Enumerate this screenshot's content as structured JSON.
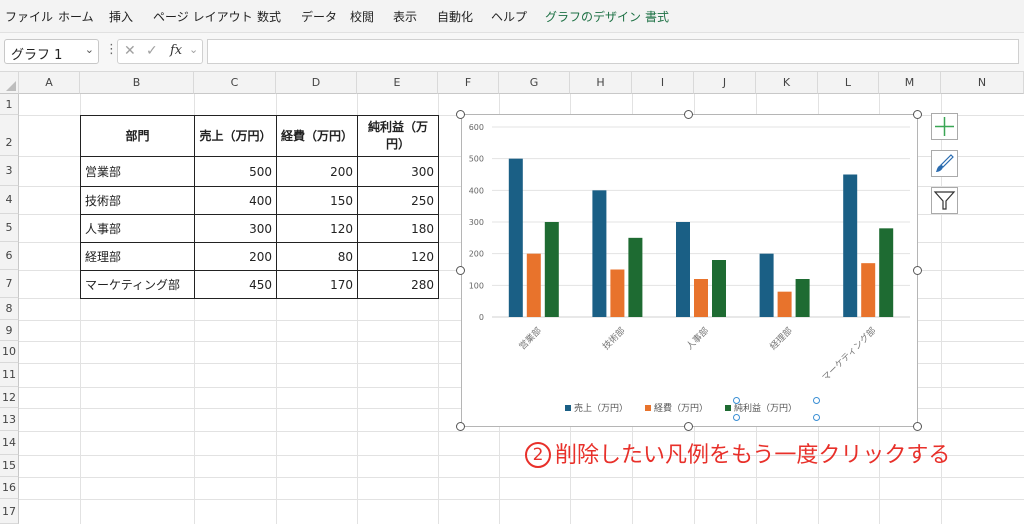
{
  "ribbon": {
    "tabs": [
      "ファイル",
      "ホーム",
      "挿入",
      "ページ レイアウト",
      "数式",
      "データ",
      "校閲",
      "表示",
      "自動化",
      "ヘルプ",
      "グラフのデザイン",
      "書式"
    ]
  },
  "formula_bar": {
    "name_box": "グラフ 1",
    "fx": "fx",
    "value": ""
  },
  "columns": [
    "A",
    "B",
    "C",
    "D",
    "E",
    "F",
    "G",
    "H",
    "I",
    "J",
    "K",
    "L",
    "M",
    "N"
  ],
  "rows": [
    "1",
    "2",
    "3",
    "4",
    "5",
    "6",
    "7",
    "8",
    "9",
    "10",
    "11",
    "12",
    "13",
    "14",
    "15",
    "16",
    "17"
  ],
  "table": {
    "headers": [
      "部門",
      "売上（万円）",
      "経費（万円）",
      "純利益（万円）"
    ],
    "rows": [
      [
        "営業部",
        "500",
        "200",
        "300"
      ],
      [
        "技術部",
        "400",
        "150",
        "250"
      ],
      [
        "人事部",
        "300",
        "120",
        "180"
      ],
      [
        "経理部",
        "200",
        "80",
        "120"
      ],
      [
        "マーケティング部",
        "450",
        "170",
        "280"
      ]
    ]
  },
  "chart_data": {
    "type": "bar",
    "title": "",
    "xlabel": "",
    "ylabel": "",
    "categories": [
      "営業部",
      "技術部",
      "人事部",
      "経理部",
      "マーケティング部"
    ],
    "series": [
      {
        "name": "売上（万円）",
        "values": [
          500,
          400,
          300,
          200,
          450
        ],
        "color": "#1a5f85"
      },
      {
        "name": "経費（万円）",
        "values": [
          200,
          150,
          120,
          80,
          170
        ],
        "color": "#e8732c"
      },
      {
        "name": "純利益（万円）",
        "values": [
          300,
          250,
          180,
          120,
          280
        ],
        "color": "#1e6b32"
      }
    ],
    "y_ticks": [
      "0",
      "100",
      "200",
      "300",
      "400",
      "500",
      "600"
    ],
    "ylim": [
      0,
      600
    ],
    "grid": true,
    "legend": "bottom"
  },
  "side_buttons": [
    "chart-elements-icon",
    "chart-styles-icon",
    "chart-filters-icon"
  ],
  "annotation": {
    "number": "2",
    "text": "削除したい凡例をもう一度クリックする",
    "color": "#e8302a"
  }
}
